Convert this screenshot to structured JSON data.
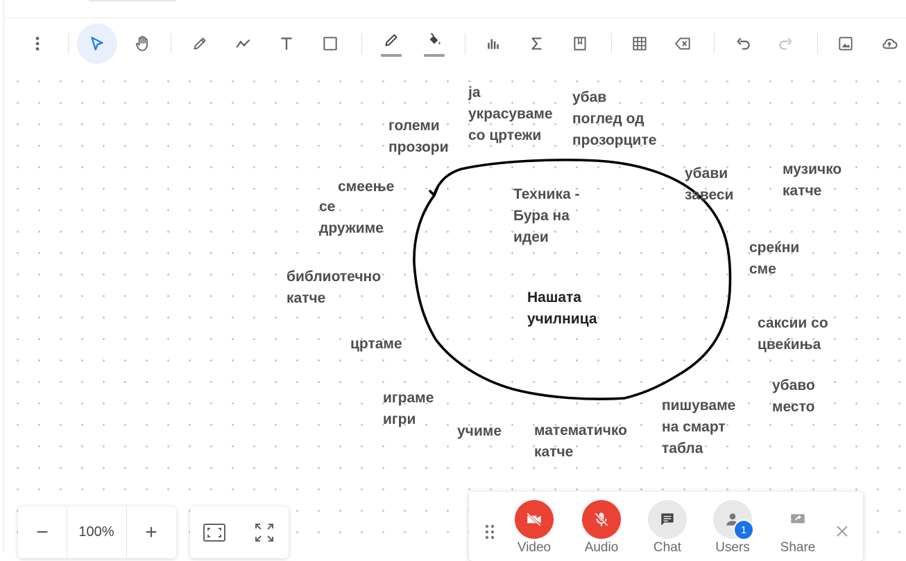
{
  "toolbar": {
    "items": [
      {
        "name": "more-menu",
        "icon": "more-vert-icon"
      },
      {
        "name": "select",
        "icon": "cursor-icon",
        "active": true
      },
      {
        "name": "pan",
        "icon": "hand-icon"
      },
      {
        "name": "pen",
        "icon": "pencil-icon"
      },
      {
        "name": "line",
        "icon": "polyline-icon"
      },
      {
        "name": "text",
        "icon": "text-icon"
      },
      {
        "name": "shape",
        "icon": "square-icon"
      },
      {
        "name": "stroke-color",
        "icon": "pen-color-icon"
      },
      {
        "name": "fill-color",
        "icon": "fill-bucket-icon"
      },
      {
        "name": "chart",
        "icon": "bar-chart-icon"
      },
      {
        "name": "formula",
        "icon": "sigma-icon"
      },
      {
        "name": "sticky-note",
        "icon": "note-icon"
      },
      {
        "name": "table",
        "icon": "grid-icon"
      },
      {
        "name": "clear",
        "icon": "backspace-icon"
      },
      {
        "name": "undo",
        "icon": "undo-icon"
      },
      {
        "name": "redo",
        "icon": "redo-icon"
      },
      {
        "name": "insert-image",
        "icon": "image-icon"
      },
      {
        "name": "cloud-save",
        "icon": "cloud-upload-icon"
      }
    ],
    "colors": {
      "active_bg": "#e8f0fe",
      "active_icon": "#1a73e8",
      "icon": "#5f6368",
      "underline": "#9e9e9e"
    }
  },
  "board": {
    "center_title": "Техника -\nБура на\nидеи",
    "center_topic": "Нашата\nучилница",
    "notes": [
      {
        "id": "note-golemi-prozori",
        "text": "големи\nпрозори"
      },
      {
        "id": "note-ja-ukrasuvame",
        "text": "ја\nукрасуваме\nсо цртежи"
      },
      {
        "id": "note-ubav-pogled",
        "text": "убав\nпоглед од\nпрозорците"
      },
      {
        "id": "note-ubavi-zavesi",
        "text": "убави\nзавеси"
      },
      {
        "id": "note-muzicko-katche",
        "text": "музичко\nкатче"
      },
      {
        "id": "note-smeenje",
        "text": "смеење"
      },
      {
        "id": "note-se-druzime",
        "text": "се\nдружиме"
      },
      {
        "id": "note-srekni-sme",
        "text": "среќни\nсме"
      },
      {
        "id": "note-biblioteчno",
        "text": "библиотечно\nкатче"
      },
      {
        "id": "note-saksii",
        "text": "саксии со\nцвеќиња"
      },
      {
        "id": "note-crtame",
        "text": "цртаме"
      },
      {
        "id": "note-ubavo-mesto",
        "text": "убаво\nместо"
      },
      {
        "id": "note-igrame-igri",
        "text": "играме\nигри"
      },
      {
        "id": "note-pishuvame",
        "text": "пишуваме\nна смарт\nтабла"
      },
      {
        "id": "note-uchime",
        "text": "учиме"
      },
      {
        "id": "note-matematichko",
        "text": "математичко\nкатче"
      }
    ],
    "ink_color": "#000000",
    "text_color": "#4f4f4f"
  },
  "zoom": {
    "minus": "−",
    "level": "100%",
    "plus": "+"
  },
  "view": {
    "fit_icon": "fit-screen-icon",
    "fullscreen_icon": "fullscreen-icon"
  },
  "meet": {
    "video_label": "Video",
    "audio_label": "Audio",
    "chat_label": "Chat",
    "users_label": "Users",
    "users_count": "1",
    "share_label": "Share",
    "colors": {
      "off_red": "#ea4335",
      "neutral_bg": "#e8e8e8",
      "badge": "#1a73e8"
    }
  }
}
